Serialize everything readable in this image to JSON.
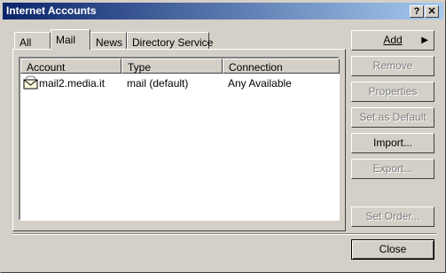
{
  "window": {
    "title": "Internet Accounts",
    "help_label": "?",
    "close_label": "✕"
  },
  "tabs": [
    {
      "label": "All"
    },
    {
      "label": "Mail"
    },
    {
      "label": "News"
    },
    {
      "label": "Directory Service"
    }
  ],
  "list": {
    "columns": [
      "Account",
      "Type",
      "Connection"
    ],
    "rows": [
      {
        "account": "mail2.media.it",
        "type": "mail (default)",
        "connection": "Any Available"
      }
    ]
  },
  "buttons": {
    "add": "Add",
    "remove": "Remove",
    "properties": "Properties",
    "set_default": "Set as Default",
    "import": "Import...",
    "export": "Export...",
    "set_order": "Set Order...",
    "close": "Close"
  },
  "icons": {
    "account": "mail-account-icon",
    "add_arrow": "triangle-right-icon"
  }
}
